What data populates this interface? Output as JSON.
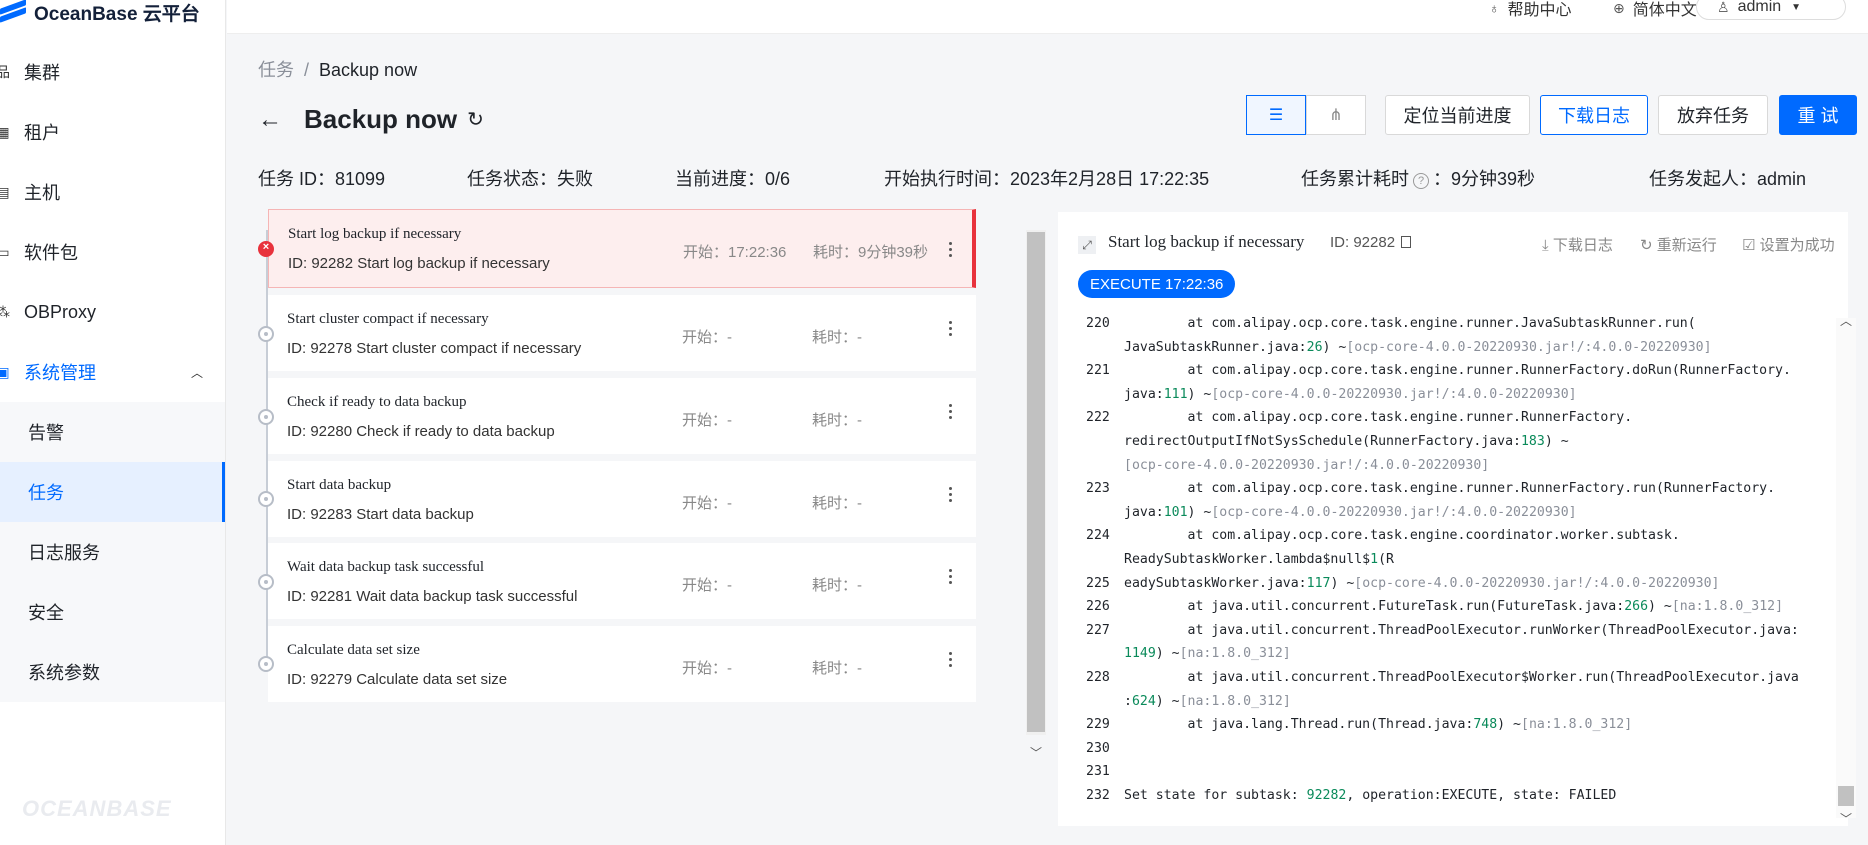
{
  "brand": {
    "name": "OceanBase 云平台",
    "footer_logo": "OCEANBASE"
  },
  "topbar": {
    "help": "帮助中心",
    "language": "简体中文",
    "user": "admin"
  },
  "sidebar": {
    "items": [
      {
        "label": "集群",
        "icon": "cluster-icon"
      },
      {
        "label": "租户",
        "icon": "tenant-icon"
      },
      {
        "label": "主机",
        "icon": "host-icon"
      },
      {
        "label": "软件包",
        "icon": "package-icon"
      },
      {
        "label": "OBProxy",
        "icon": "proxy-icon"
      },
      {
        "label": "系统管理",
        "icon": "system-icon"
      }
    ],
    "sub_items": [
      "告警",
      "任务",
      "日志服务",
      "安全",
      "系统参数"
    ],
    "active_sub": "任务"
  },
  "breadcrumb": {
    "parent": "任务",
    "separator": "/",
    "current": "Backup now"
  },
  "page": {
    "title": "Backup now"
  },
  "actions": {
    "locate": "定位当前进度",
    "download": "下载日志",
    "abandon": "放弃任务",
    "retry": "重 试"
  },
  "info": {
    "task_id_label": "任务 ID：",
    "task_id": "81099",
    "status_label": "任务状态：",
    "status": "失败",
    "progress_label": "当前进度：",
    "progress": "0/6",
    "start_label": "开始执行时间：",
    "start": "2023年2月28日 17:22:35",
    "elapsed_label": "任务累计耗时",
    "elapsed": "：9分钟39秒",
    "initiator_label": "任务发起人：",
    "initiator": "admin"
  },
  "tasks": [
    {
      "name": "Start log backup if necessary",
      "id_line": "ID: 92282   Start log backup if necessary",
      "start": "开始：17:22:36",
      "duration": "耗时：9分钟39秒",
      "status": "failed"
    },
    {
      "name": "Start cluster compact if necessary",
      "id_line": "ID: 92278   Start cluster compact if necessary",
      "start": "开始：-",
      "duration": "耗时：-",
      "status": "pending"
    },
    {
      "name": "Check if ready to data backup",
      "id_line": "ID: 92280   Check if ready to data backup",
      "start": "开始：-",
      "duration": "耗时：-",
      "status": "pending"
    },
    {
      "name": "Start data backup",
      "id_line": "ID: 92283   Start data backup",
      "start": "开始：-",
      "duration": "耗时：-",
      "status": "pending"
    },
    {
      "name": "Wait data backup task successful",
      "id_line": "ID: 92281   Wait data backup task successful",
      "start": "开始：-",
      "duration": "耗时：-",
      "status": "pending"
    },
    {
      "name": "Calculate data set size",
      "id_line": "ID: 92279   Calculate data set size",
      "start": "开始：-",
      "duration": "耗时：-",
      "status": "pending"
    }
  ],
  "detail": {
    "name": "Start log backup if necessary",
    "id": "ID: 92282",
    "download": "下载日志",
    "rerun": "重新运行",
    "set_success": "设置为成功",
    "badge": "EXECUTE 17:22:36"
  },
  "log": [
    {
      "n": "220",
      "parts": [
        [
          "        at com.alipay.ocp.core.task.engine.runner.JavaSubtaskRunner.run(",
          ""
        ]
      ]
    },
    {
      "n": "",
      "parts": [
        [
          "JavaSubtaskRunner.java:",
          ""
        ],
        [
          "26",
          "n"
        ],
        [
          ") ~",
          ""
        ],
        [
          "[ocp-core-4.0.0-20220930.jar!/:4.0.0-20220930]",
          "g"
        ]
      ]
    },
    {
      "n": "221",
      "parts": [
        [
          "        at com.alipay.ocp.core.task.engine.runner.RunnerFactory.doRun(RunnerFactory.",
          ""
        ]
      ]
    },
    {
      "n": "",
      "parts": [
        [
          "java:",
          ""
        ],
        [
          "111",
          "n"
        ],
        [
          ") ~",
          ""
        ],
        [
          "[ocp-core-4.0.0-20220930.jar!/:4.0.0-20220930]",
          "g"
        ]
      ]
    },
    {
      "n": "222",
      "parts": [
        [
          "        at com.alipay.ocp.core.task.engine.runner.RunnerFactory.",
          ""
        ]
      ]
    },
    {
      "n": "",
      "parts": [
        [
          "redirectOutputIfNotSysSchedule(RunnerFactory.java:",
          ""
        ],
        [
          "183",
          "n"
        ],
        [
          ") ~",
          ""
        ]
      ]
    },
    {
      "n": "",
      "parts": [
        [
          "[ocp-core-4.0.0-20220930.jar!/:4.0.0-20220930]",
          "g"
        ]
      ]
    },
    {
      "n": "223",
      "parts": [
        [
          "        at com.alipay.ocp.core.task.engine.runner.RunnerFactory.run(RunnerFactory.",
          ""
        ]
      ]
    },
    {
      "n": "",
      "parts": [
        [
          "java:",
          ""
        ],
        [
          "101",
          "n"
        ],
        [
          ") ~",
          ""
        ],
        [
          "[ocp-core-4.0.0-20220930.jar!/:4.0.0-20220930]",
          "g"
        ]
      ]
    },
    {
      "n": "224",
      "parts": [
        [
          "        at com.alipay.ocp.core.task.engine.coordinator.worker.subtask.",
          ""
        ]
      ]
    },
    {
      "n": "",
      "parts": [
        [
          "ReadySubtaskWorker.lambda$null$",
          ""
        ],
        [
          "1",
          "n"
        ],
        [
          "(R",
          ""
        ]
      ]
    },
    {
      "n": "225",
      "parts": [
        [
          "eadySubtaskWorker.java:",
          ""
        ],
        [
          "117",
          "n"
        ],
        [
          ") ~",
          ""
        ],
        [
          "[ocp-core-4.0.0-20220930.jar!/:4.0.0-20220930]",
          "g"
        ]
      ]
    },
    {
      "n": "226",
      "parts": [
        [
          "        at java.util.concurrent.FutureTask.run(FutureTask.java:",
          ""
        ],
        [
          "266",
          "n"
        ],
        [
          ") ~",
          ""
        ],
        [
          "[na:1.8.0_312]",
          "g"
        ]
      ]
    },
    {
      "n": "227",
      "parts": [
        [
          "        at java.util.concurrent.ThreadPoolExecutor.runWorker(ThreadPoolExecutor.java:",
          ""
        ]
      ]
    },
    {
      "n": "",
      "parts": [
        [
          "1149",
          "n"
        ],
        [
          ") ~",
          ""
        ],
        [
          "[na:1.8.0_312]",
          "g"
        ]
      ]
    },
    {
      "n": "228",
      "parts": [
        [
          "        at java.util.concurrent.ThreadPoolExecutor$Worker.run(ThreadPoolExecutor.java",
          ""
        ]
      ]
    },
    {
      "n": "",
      "parts": [
        [
          ":",
          ""
        ],
        [
          "624",
          "n"
        ],
        [
          ") ~",
          ""
        ],
        [
          "[na:1.8.0_312]",
          "g"
        ]
      ]
    },
    {
      "n": "229",
      "parts": [
        [
          "        at java.lang.Thread.run(Thread.java:",
          ""
        ],
        [
          "748",
          "n"
        ],
        [
          ") ~",
          ""
        ],
        [
          "[na:1.8.0_312]",
          "g"
        ]
      ]
    },
    {
      "n": "230",
      "parts": []
    },
    {
      "n": "231",
      "parts": []
    },
    {
      "n": "232",
      "parts": [
        [
          "Set state for subtask: ",
          ""
        ],
        [
          "92282",
          "n"
        ],
        [
          ", operation:EXECUTE, state: FAILED",
          ""
        ]
      ]
    }
  ],
  "colors": {
    "accent": "#006aff",
    "danger": "#e8323c"
  }
}
